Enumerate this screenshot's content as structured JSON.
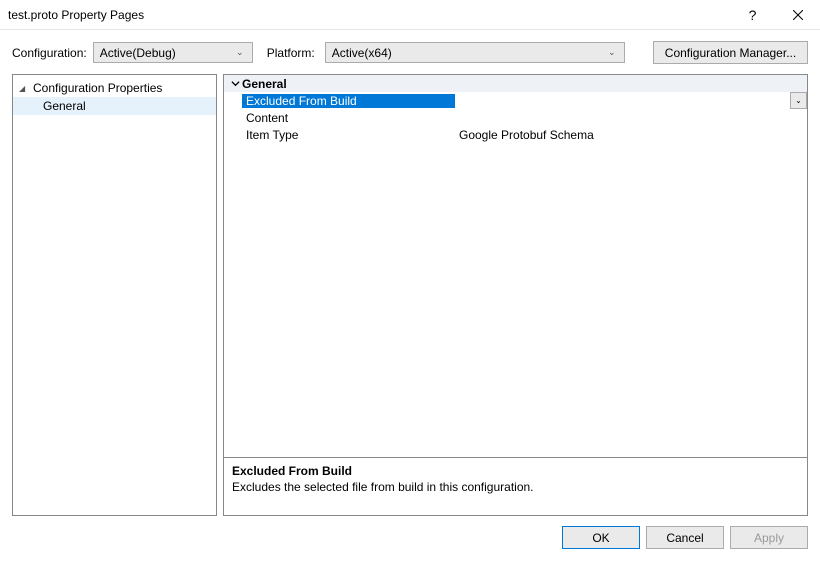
{
  "titlebar": {
    "title": "test.proto Property Pages"
  },
  "toolbar": {
    "configuration_label": "Configuration:",
    "configuration_value": "Active(Debug)",
    "platform_label": "Platform:",
    "platform_value": "Active(x64)",
    "config_manager_label": "Configuration Manager..."
  },
  "tree": {
    "root": "Configuration Properties",
    "child": "General"
  },
  "props": {
    "group": "General",
    "rows": [
      {
        "name": "Excluded From Build",
        "value": "",
        "selected": true
      },
      {
        "name": "Content",
        "value": ""
      },
      {
        "name": "Item Type",
        "value": "Google Protobuf Schema"
      }
    ]
  },
  "description": {
    "title": "Excluded From Build",
    "text": "Excludes the selected file from build in this configuration."
  },
  "buttons": {
    "ok": "OK",
    "cancel": "Cancel",
    "apply": "Apply"
  }
}
